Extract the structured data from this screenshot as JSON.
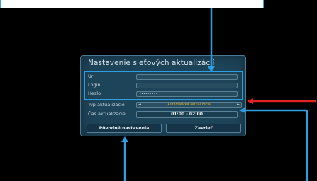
{
  "dialog": {
    "title": "Nastavenie sieťových aktualizácií",
    "credentials": {
      "url_label": "Url",
      "url_value": "",
      "login_label": "Login",
      "login_value": "",
      "password_label": "Heslo",
      "password_value": "•••••••••"
    },
    "update_type": {
      "label": "Typ aktualizácie",
      "value": "Automatická aktualizácia"
    },
    "update_time": {
      "label": "Čas aktualizácie",
      "value": "01:00 - 02:00"
    },
    "buttons": {
      "defaults": "Pôvodné nastavenia",
      "close": "Zavrieť"
    }
  },
  "colors": {
    "background": "#000000",
    "dialog_bg": "#1e4459",
    "highlight_blue": "#2d9ee2",
    "highlight_red": "#e02222",
    "accent_yellow": "#e6b020"
  }
}
